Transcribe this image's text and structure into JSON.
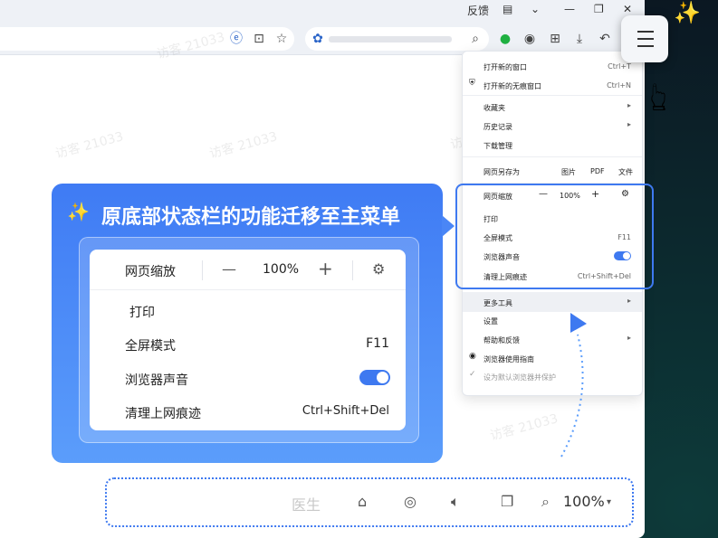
{
  "titlebar": {
    "feedback": "反馈"
  },
  "watermark": "访客 21033",
  "menu": {
    "new_window": "打开新的窗口",
    "new_window_sc": "Ctrl+T",
    "new_incognito": "打开新的无痕窗口",
    "new_incognito_sc": "Ctrl+N",
    "favorites": "收藏夹",
    "history": "历史记录",
    "downloads": "下载管理",
    "save_as": "网页另存为",
    "save_image": "图片",
    "save_pdf": "PDF",
    "save_file": "文件",
    "zoom": "网页缩放",
    "zoom_value": "100%",
    "print": "打印",
    "fullscreen": "全屏模式",
    "fullscreen_sc": "F11",
    "sound": "浏览器声音",
    "clear": "清理上网痕迹",
    "clear_sc": "Ctrl+Shift+Del",
    "more_tools": "更多工具",
    "settings": "设置",
    "help": "帮助和反馈",
    "guide": "浏览器使用指南",
    "default": "设为默认浏览器并保护"
  },
  "callout": {
    "title": "原底部状态栏的功能迁移至主菜单",
    "zoom": "网页缩放",
    "minus": "—",
    "zoom_value": "100%",
    "plus": "+",
    "print": "打印",
    "fullscreen": "全屏模式",
    "fullscreen_sc": "F11",
    "sound": "浏览器声音",
    "clear": "清理上网痕迹",
    "clear_sc": "Ctrl+Shift+Del"
  },
  "statusbar": {
    "doctor": "医生",
    "zoom_value": "100%"
  },
  "colors": {
    "accent": "#3e79f0",
    "callout": "#4a86f6"
  }
}
